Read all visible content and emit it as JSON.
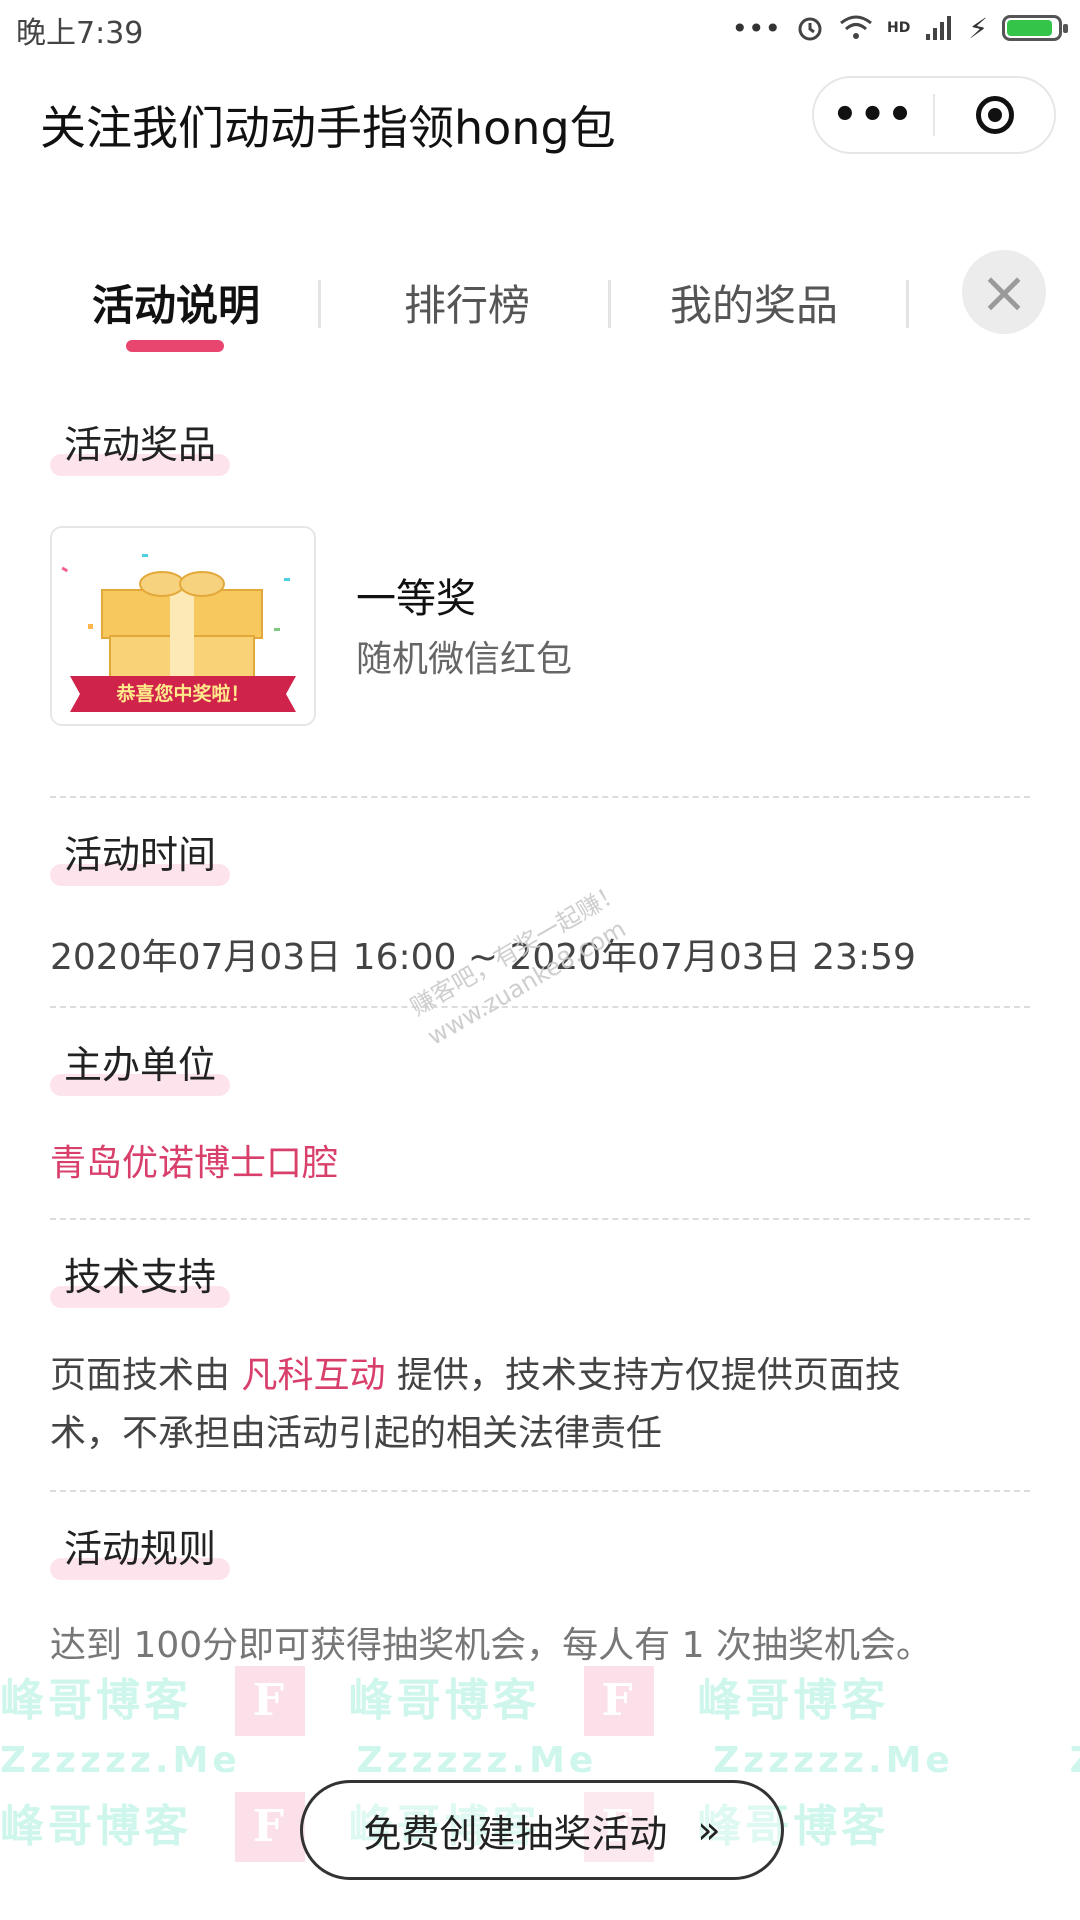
{
  "status_bar": {
    "time": "晚上7:39",
    "signal_label": "HD"
  },
  "nav": {
    "title": "关注我们动动手指领hong包",
    "menu_icon": "more-dots-icon",
    "target_icon": "target-icon"
  },
  "tabs": [
    {
      "label": "活动说明",
      "active": true
    },
    {
      "label": "排行榜",
      "active": false
    },
    {
      "label": "我的奖品",
      "active": false
    }
  ],
  "sections": {
    "prizes": {
      "label": "活动奖品",
      "items": [
        {
          "name": "一等奖",
          "desc": "随机微信红包",
          "image_banner": "恭喜您中奖啦！"
        }
      ]
    },
    "time": {
      "label": "活动时间",
      "value": "2020年07月03日 16:00 ~ 2020年07月03日 23:59"
    },
    "organizer": {
      "label": "主办单位",
      "value": "青岛优诺博士口腔"
    },
    "tech": {
      "label": "技术支持",
      "prefix": "页面技术由 ",
      "provider": "凡科互动",
      "suffix_line1": " 提供，技术支持方仅提供页面技",
      "line2": "术，不承担由活动引起的相关法律责任"
    },
    "rules": {
      "label": "活动规则",
      "text": "达到 100分即可获得抽奖机会，每人有 1 次抽奖机会。"
    }
  },
  "create_button": {
    "label": "免费创建抽奖活动",
    "icon": "double-chevron-right-icon"
  },
  "watermarks": {
    "diagonal_1": "赚客吧，有奖一起赚！",
    "diagonal_2": "www.zuanke8.com",
    "brand": "峰哥博客",
    "brand_url": "Zzzzzz.Me",
    "brand_letter": "F"
  },
  "colors": {
    "accent": "#e9466f",
    "pink_text": "#d93f6b",
    "battery": "#34c44a",
    "label_highlight": "#fde4ec"
  },
  "battery_level": 0.9
}
